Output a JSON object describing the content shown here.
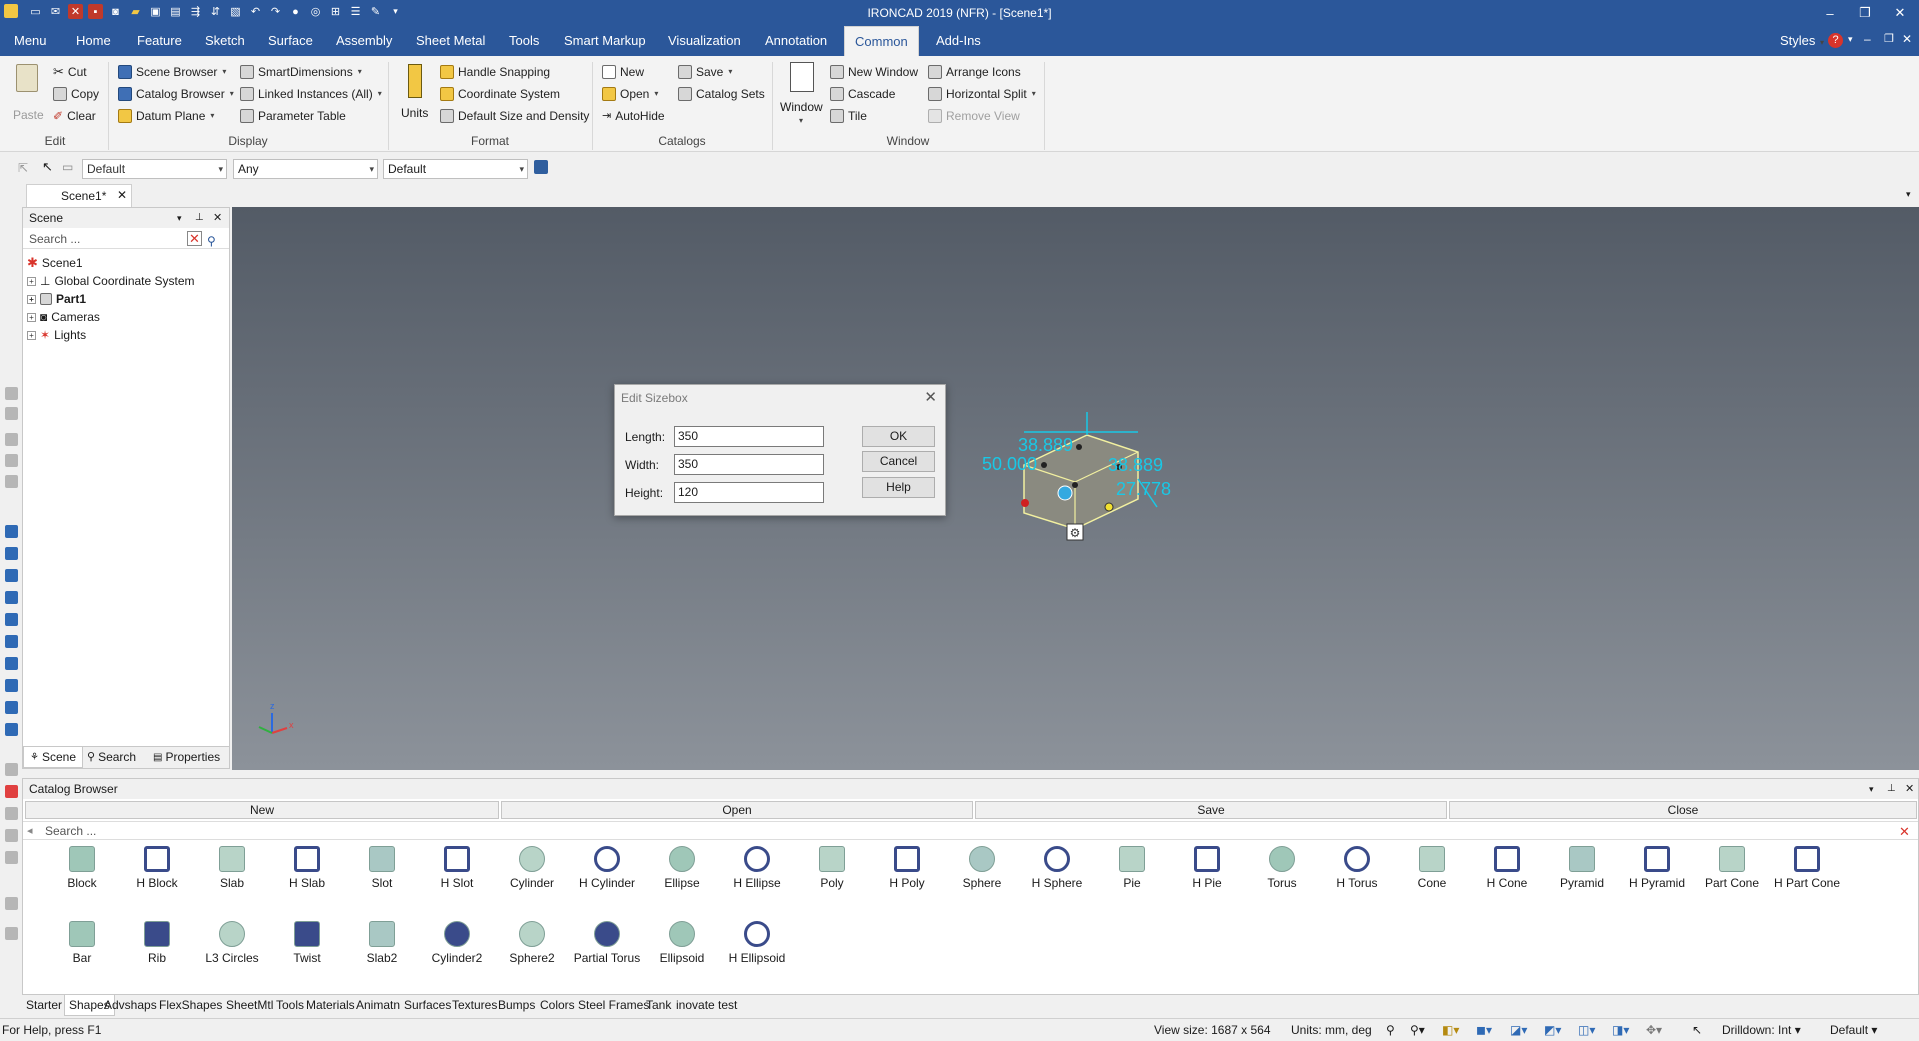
{
  "app": {
    "title": "IRONCAD 2019 (NFR) - [Scene1*]"
  },
  "menu": {
    "tabs": [
      "Menu",
      "Home",
      "Feature",
      "Sketch",
      "Surface",
      "Assembly",
      "Sheet Metal",
      "Tools",
      "Smart Markup",
      "Visualization",
      "Annotation",
      "Common",
      "Add-Ins"
    ],
    "active_tab": "Common",
    "styles_label": "Styles"
  },
  "ribbon": {
    "edit": {
      "paste": "Paste",
      "cut": "Cut",
      "copy": "Copy",
      "clear": "Clear",
      "label": "Edit"
    },
    "display": {
      "scene_browser": "Scene Browser",
      "catalog_browser": "Catalog Browser",
      "datum_plane": "Datum Plane",
      "smart_dimensions": "SmartDimensions",
      "linked_instances": "Linked Instances (All)",
      "parameter_table": "Parameter Table",
      "label": "Display"
    },
    "format": {
      "units": "Units",
      "handle_snapping": "Handle Snapping",
      "coordinate_system": "Coordinate System",
      "default_size": "Default Size and Density",
      "label": "Format"
    },
    "catalogs": {
      "new": "New",
      "open": "Open",
      "autohide": "AutoHide",
      "save": "Save",
      "catalog_sets": "Catalog Sets",
      "label": "Catalogs"
    },
    "window": {
      "window": "Window",
      "new_window": "New Window",
      "cascade": "Cascade",
      "tile": "Tile",
      "arrange_icons": "Arrange Icons",
      "horizontal_split": "Horizontal Split",
      "remove_view": "Remove View",
      "label": "Window"
    }
  },
  "toolbar2": {
    "combo1": "Default",
    "combo2": "Any",
    "combo3": "Default"
  },
  "document": {
    "tab": "Scene1*"
  },
  "scene": {
    "header": "Scene",
    "search_placeholder": "Search ...",
    "tree": [
      "Scene1",
      "Global Coordinate System",
      "Part1",
      "Cameras",
      "Lights"
    ],
    "tabs": [
      "Scene",
      "Search",
      "Properties"
    ]
  },
  "viewport": {
    "dims": [
      "38.889",
      "50.000",
      "38.889",
      "27.778"
    ]
  },
  "dialog": {
    "title": "Edit Sizebox",
    "length_label": "Length:",
    "length_value": "350",
    "width_label": "Width:",
    "width_value": "350",
    "height_label": "Height:",
    "height_value": "120",
    "ok": "OK",
    "cancel": "Cancel",
    "help": "Help"
  },
  "catalog": {
    "header": "Catalog Browser",
    "buttons": [
      "New",
      "Open",
      "Save",
      "Close"
    ],
    "search_placeholder": "Search ...",
    "items_row1": [
      "Block",
      "H Block",
      "Slab",
      "H Slab",
      "Slot",
      "H Slot",
      "Cylinder",
      "H Cylinder",
      "Ellipse",
      "H Ellipse",
      "Poly",
      "H Poly",
      "Sphere",
      "H Sphere",
      "Pie",
      "H Pie",
      "Torus",
      "H Torus",
      "Cone",
      "H Cone",
      "Pyramid",
      "H Pyramid",
      "Part Cone",
      "H Part Cone"
    ],
    "items_row2": [
      "Bar",
      "Rib",
      "L3 Circles",
      "Twist",
      "Slab2",
      "Cylinder2",
      "Sphere2",
      "Partial Torus",
      "Ellipsoid",
      "H Ellipsoid"
    ],
    "tabs": [
      "Starter",
      "Shapes",
      "Advshaps",
      "FlexShapes",
      "SheetMtl",
      "Tools",
      "Materials",
      "Animatn",
      "Surfaces",
      "Textures",
      "Bumps",
      "Colors",
      "Steel Frames",
      "Tank",
      "inovate test"
    ],
    "active_tab": "Shapes"
  },
  "status": {
    "help": "For Help, press F1",
    "view_size": "View size: 1687 x  564",
    "units": "Units: mm, deg",
    "drilldown": "Drilldown: Int",
    "default": "Default"
  },
  "colors": {
    "accent": "#2b579a",
    "dim": "#19c8e6"
  }
}
